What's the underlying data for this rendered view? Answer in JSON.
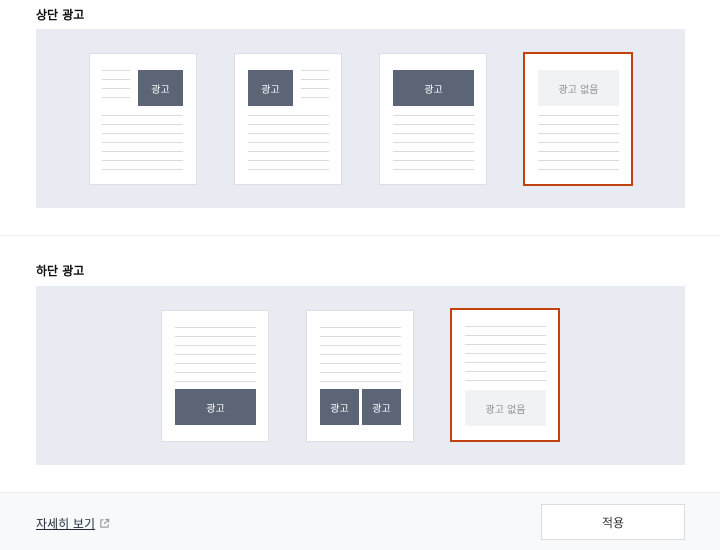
{
  "top_section": {
    "title": "상단 광고",
    "options": [
      {
        "ad_label": "광고"
      },
      {
        "ad_label": "광고"
      },
      {
        "ad_label": "광고"
      },
      {
        "ad_label": "광고 없음",
        "selected": true
      }
    ]
  },
  "bottom_section": {
    "title": "하단 광고",
    "options": [
      {
        "ad_label": "광고"
      },
      {
        "ad_labels": [
          "광고",
          "광고"
        ]
      },
      {
        "ad_label": "광고 없음",
        "selected": true
      }
    ]
  },
  "footer": {
    "detail_link": "자세히 보기",
    "apply_label": "적용"
  },
  "colors": {
    "panel_bg": "#e8ecf2",
    "ad_block": "#5b6576",
    "selected_border": "#c2410c"
  }
}
